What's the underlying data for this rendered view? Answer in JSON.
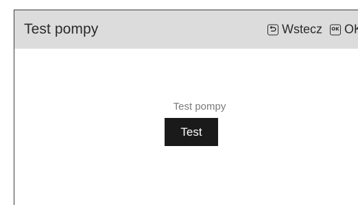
{
  "header": {
    "title": "Test pompy",
    "back_label": "Wstecz",
    "back_icon": "back-arrow-icon",
    "ok_icon_text": "OK",
    "ok_label": "OK",
    "ok_icon": "ok-key-icon"
  },
  "main": {
    "label": "Test pompy",
    "button_label": "Test"
  },
  "colors": {
    "header_background": "#dcdcdc",
    "button_background": "#1a1a1a",
    "button_text": "#ffffff",
    "label_text": "#7a7a7a"
  }
}
